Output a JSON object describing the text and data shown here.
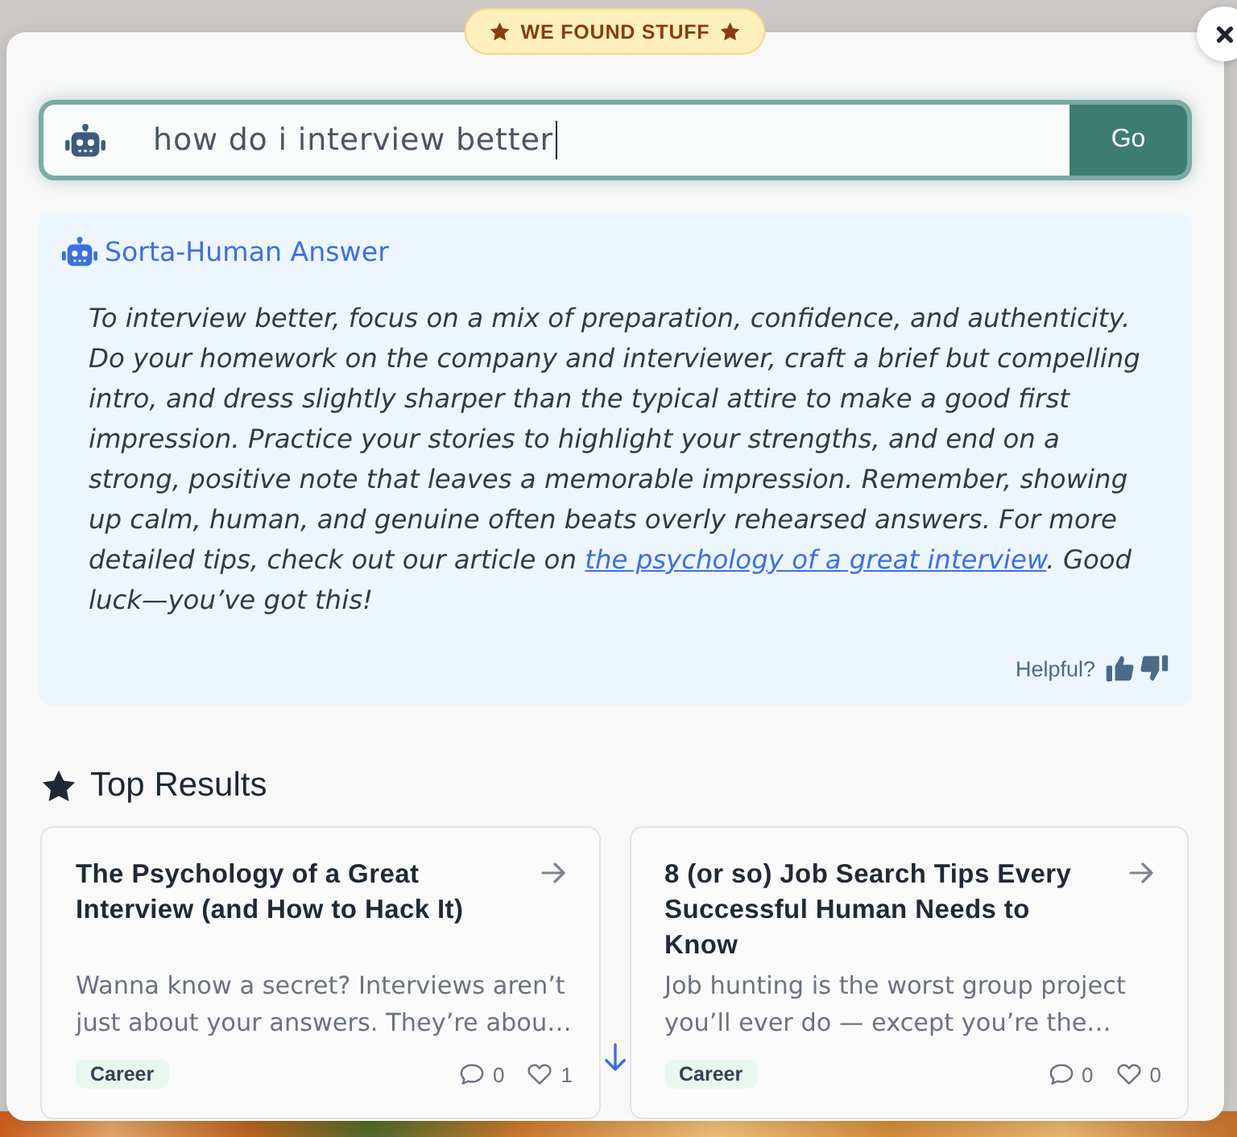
{
  "badge": {
    "text": "WE FOUND STUFF"
  },
  "search": {
    "value": "how do i interview better",
    "button": "Go"
  },
  "answer": {
    "title": "Sorta-Human Answer",
    "text_before": "To interview better, focus on a mix of preparation, confidence, and authenticity. Do your homework on the company and interviewer, craft a brief but compelling intro, and dress slightly sharper than the typical attire to make a good first impression. Practice your stories to highlight your strengths, and end on a strong, positive note that leaves a memorable impression. Remember, showing up calm, human, and genuine often beats overly rehearsed answers. For more detailed tips, check out our article on ",
    "link": "the psychology of a great interview",
    "text_after": ". Good luck—you’ve got this!",
    "feedback_label": "Helpful?"
  },
  "top_results": {
    "title": "Top Results",
    "cards": [
      {
        "title": "The Psychology of a Great Interview (and How to Hack It)",
        "excerpt": "Wanna know a secret? Interviews aren’t just about your answers. They’re abou…",
        "tag": "Career",
        "comments": "0",
        "likes": "1"
      },
      {
        "title": "8 (or so) Job Search Tips Every Successful Human Needs to Know",
        "excerpt": "Job hunting is the worst group project you’ll ever do — except you’re the…",
        "tag": "Career",
        "comments": "0",
        "likes": "0"
      }
    ]
  }
}
